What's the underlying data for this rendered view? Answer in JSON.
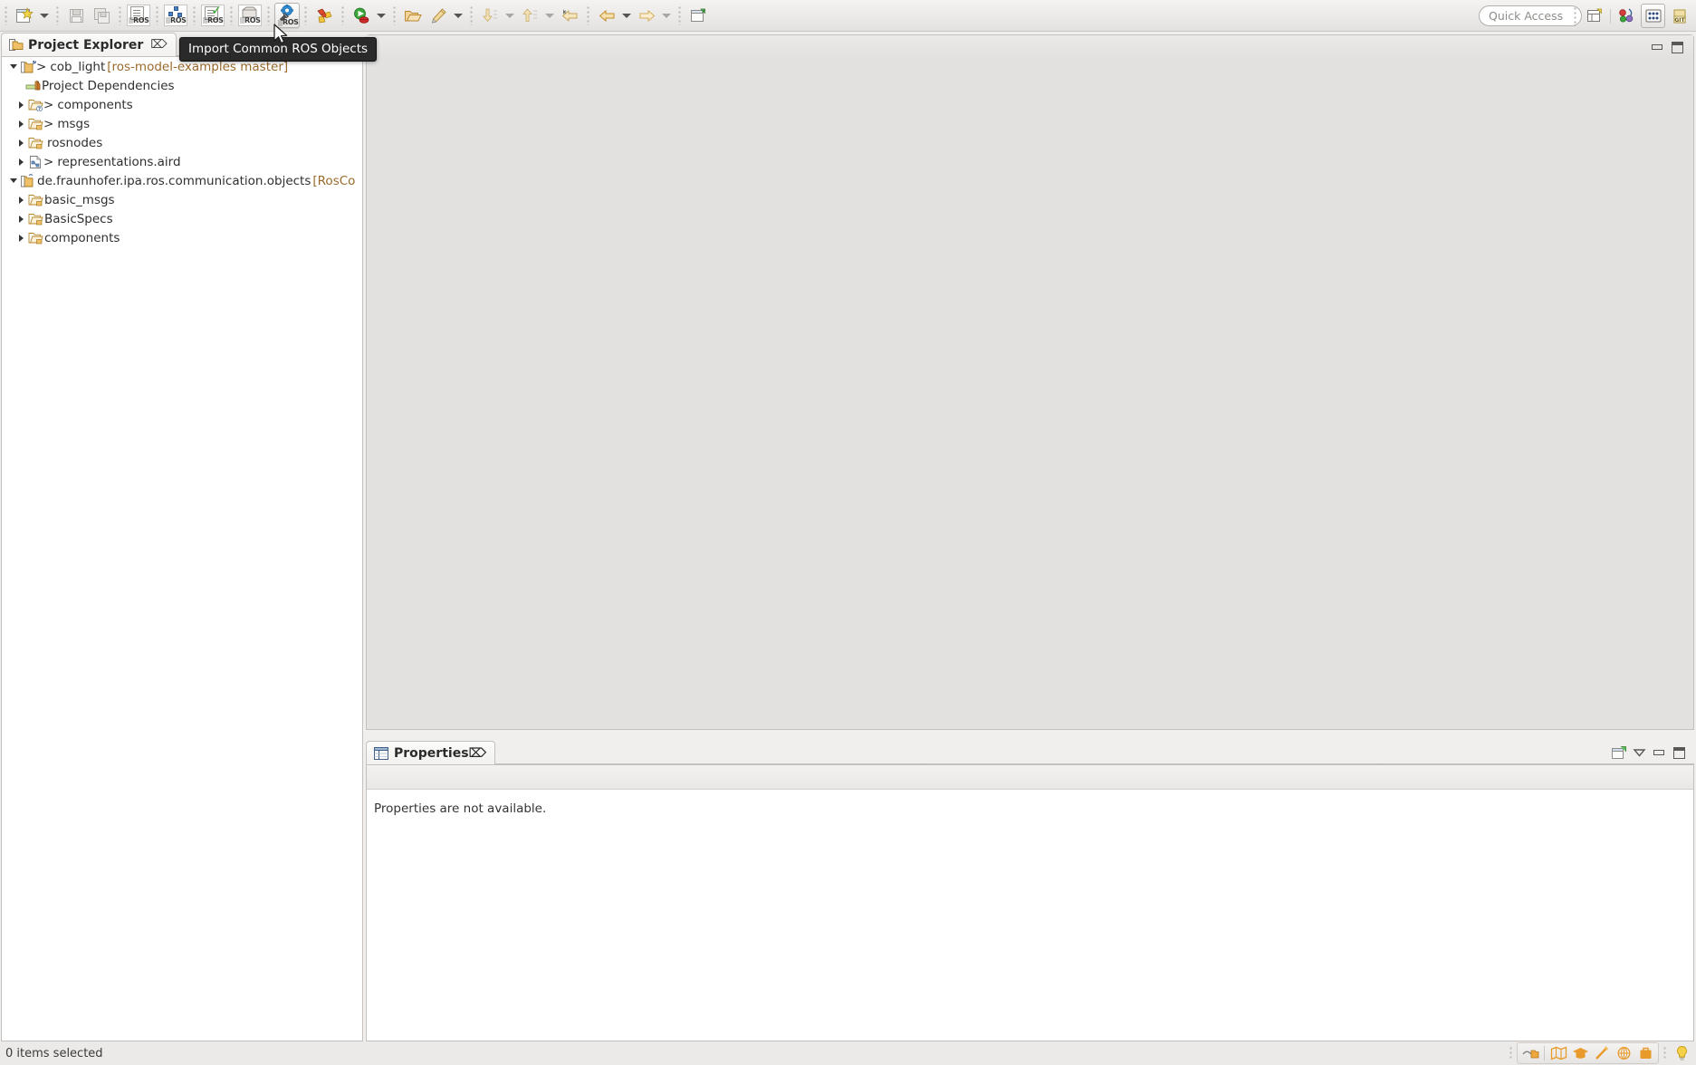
{
  "toolbar": {
    "items": [
      {
        "name": "new-wizard-button",
        "label": "New",
        "icon": "new-file-icon",
        "type": "button"
      },
      {
        "name": "new-dropdown",
        "label": "New menu",
        "icon": "chevron-down-icon",
        "type": "dropdown"
      },
      {
        "name": "save-button",
        "label": "Save",
        "icon": "save-icon",
        "type": "button",
        "enabled": false
      },
      {
        "name": "save-all-button",
        "label": "Save All",
        "icon": "save-all-icon",
        "type": "button",
        "enabled": false
      },
      {
        "name": "new-ros-package-button",
        "label": "New ROS Package",
        "icon": "ros-document-icon",
        "type": "button"
      },
      {
        "name": "new-ros-model-button",
        "label": "New ROS Model",
        "icon": "ros-diagram-icon",
        "type": "button"
      },
      {
        "name": "validate-ros-button",
        "label": "Validate ROS Model",
        "icon": "ros-check-icon",
        "type": "button"
      },
      {
        "name": "ros-package-set-button",
        "label": "ROS Package Set",
        "icon": "ros-package-icon",
        "type": "button"
      },
      {
        "name": "import-common-ros-objects-button",
        "label": "Import Common ROS Objects",
        "icon": "ros-gear-wrench-icon",
        "type": "button",
        "pressed": true
      },
      {
        "name": "external-tools-button",
        "label": "External Tools",
        "icon": "tools-icon",
        "type": "button"
      },
      {
        "name": "run-button",
        "label": "Run",
        "icon": "run-green-icon",
        "type": "button"
      },
      {
        "name": "run-dropdown",
        "label": "Run menu",
        "icon": "chevron-down-icon",
        "type": "dropdown"
      },
      {
        "name": "open-resource-button",
        "label": "Open Resource",
        "icon": "open-folder-icon",
        "type": "button"
      },
      {
        "name": "pin-editor-button",
        "label": "Pin Editor",
        "icon": "pencil-icon",
        "type": "button"
      },
      {
        "name": "pin-editor-dropdown",
        "label": "Pin Editor menu",
        "icon": "chevron-down-icon",
        "type": "dropdown"
      },
      {
        "name": "next-annotation-button",
        "label": "Next Annotation",
        "icon": "down-arrow-list-icon",
        "type": "button",
        "enabled": false
      },
      {
        "name": "next-annotation-dropdown",
        "label": "Next Annotation menu",
        "icon": "chevron-down-icon",
        "type": "dropdown",
        "enabled": false
      },
      {
        "name": "previous-annotation-button",
        "label": "Previous Annotation",
        "icon": "up-arrow-list-icon",
        "type": "button",
        "enabled": false
      },
      {
        "name": "previous-annotation-dropdown",
        "label": "Previous Annotation menu",
        "icon": "chevron-down-icon",
        "type": "dropdown",
        "enabled": false
      },
      {
        "name": "last-edit-location-button",
        "label": "Last Edit Location",
        "icon": "back-star-arrow-icon",
        "type": "button"
      },
      {
        "name": "back-button",
        "label": "Back",
        "icon": "back-arrow-icon",
        "type": "button"
      },
      {
        "name": "back-dropdown",
        "label": "Back menu",
        "icon": "chevron-down-icon",
        "type": "dropdown"
      },
      {
        "name": "forward-button",
        "label": "Forward",
        "icon": "forward-arrow-icon",
        "type": "button"
      },
      {
        "name": "forward-dropdown",
        "label": "Forward menu",
        "icon": "chevron-down-icon",
        "type": "dropdown",
        "enabled": false
      },
      {
        "name": "new-window-button",
        "label": "New Window",
        "icon": "new-window-icon",
        "type": "button"
      }
    ],
    "quick_access": {
      "name": "quick-access-field",
      "placeholder": "Quick Access",
      "value": ""
    },
    "perspectives": [
      {
        "name": "open-perspective-button",
        "label": "Open Perspective",
        "icon": "open-perspective-icon"
      },
      {
        "name": "perspective-ros-button",
        "label": "ROS",
        "icon": "ros-perspective-icon"
      },
      {
        "name": "perspective-resource-button",
        "label": "Resource",
        "icon": "grid-dots-icon",
        "active": true
      },
      {
        "name": "perspective-git-button",
        "label": "Git",
        "icon": "git-icon"
      }
    ]
  },
  "tooltip": {
    "name": "toolbar-tooltip",
    "text": "Import Common ROS Objects"
  },
  "explorer": {
    "tab": {
      "title": "Project Explorer",
      "close_glyph": "⌦"
    },
    "tree": [
      {
        "label": "cob_light",
        "decoration": "[ros-model-examples master]",
        "icon": "project-icon",
        "indent": 0,
        "twisty": "down",
        "prefix": ">"
      },
      {
        "label": "Project Dependencies",
        "decoration": "",
        "icon": "library-icon",
        "indent": 1,
        "twisty": "none",
        "prefix": ""
      },
      {
        "label": "components",
        "decoration": "",
        "icon": "folder-question-icon",
        "indent": 1,
        "twisty": "right",
        "prefix": ">"
      },
      {
        "label": "msgs",
        "decoration": "",
        "icon": "folder-icon",
        "indent": 1,
        "twisty": "right",
        "prefix": ">"
      },
      {
        "label": "rosnodes",
        "decoration": "",
        "icon": "folder-icon",
        "indent": 1,
        "twisty": "right",
        "prefix": ""
      },
      {
        "label": "representations.aird",
        "decoration": "",
        "icon": "aird-file-icon",
        "indent": 1,
        "twisty": "right",
        "prefix": ">"
      },
      {
        "label": "de.fraunhofer.ipa.ros.communication.objects",
        "decoration": "[RosCo",
        "icon": "project-icon",
        "indent": 0,
        "twisty": "down",
        "prefix": ""
      },
      {
        "label": "basic_msgs",
        "decoration": "",
        "icon": "folder-icon",
        "indent": 1,
        "twisty": "right",
        "prefix": ""
      },
      {
        "label": "BasicSpecs",
        "decoration": "",
        "icon": "folder-icon",
        "indent": 1,
        "twisty": "right",
        "prefix": ""
      },
      {
        "label": "components",
        "decoration": "",
        "icon": "folder-icon",
        "indent": 1,
        "twisty": "right",
        "prefix": ""
      }
    ]
  },
  "editor": {
    "name": "editor-area",
    "controls": [
      {
        "name": "editor-minimize-button",
        "icon": "minimize-icon"
      },
      {
        "name": "editor-maximize-button",
        "icon": "maximize-icon"
      }
    ]
  },
  "properties": {
    "tab": {
      "title": "Properties",
      "close_glyph": "⌦"
    },
    "message": "Properties are not available.",
    "controls": [
      {
        "name": "properties-pin-button",
        "icon": "pin-view-icon"
      },
      {
        "name": "properties-menu-button",
        "icon": "view-menu-icon"
      },
      {
        "name": "properties-minimize-button",
        "icon": "minimize-icon"
      },
      {
        "name": "properties-maximize-button",
        "icon": "maximize-icon"
      }
    ]
  },
  "statusbar": {
    "text": "0 items selected",
    "icons": [
      {
        "name": "status-build-icon",
        "icon": "build-icon"
      },
      {
        "name": "status-map-icon",
        "icon": "map-icon"
      },
      {
        "name": "status-graduation-icon",
        "icon": "graduation-cap-icon"
      },
      {
        "name": "status-wand-icon",
        "icon": "magic-wand-icon"
      },
      {
        "name": "status-globe-icon",
        "icon": "globe-icon"
      },
      {
        "name": "status-briefcase-icon",
        "icon": "briefcase-icon"
      },
      {
        "name": "status-tip-icon",
        "icon": "lightbulb-icon"
      }
    ]
  },
  "colors": {
    "toolbar_bg": "#eceae8",
    "panel_border": "#c3c0bd",
    "tree_bg": "#ffffff",
    "editor_bg": "#e3e1e0",
    "decoration_text": "#9a6a2c",
    "tooltip_bg": "#2a2a2a",
    "folder_orange": "#e8a33d",
    "accent_blue": "#4a7fc1"
  }
}
